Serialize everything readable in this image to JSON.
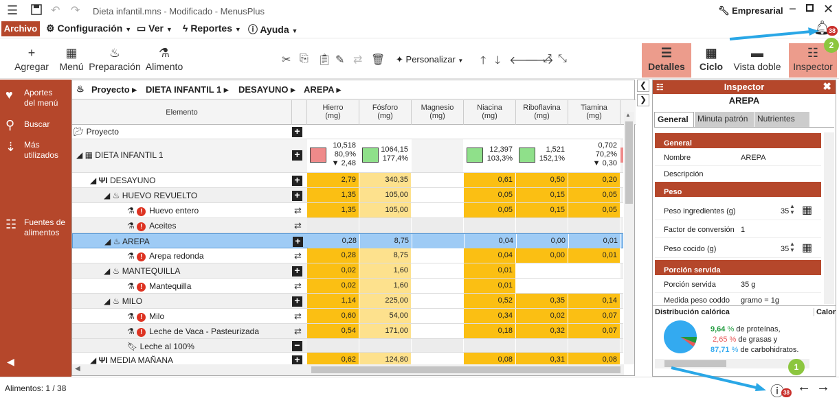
{
  "window": {
    "title": "Dieta infantil.mns - Modificado - MenusPlus",
    "edition": "Empresarial",
    "notification_count": "38"
  },
  "menubar": {
    "archivo": "Archivo",
    "configuracion": "Configuración",
    "ver": "Ver",
    "reportes": "Reportes",
    "ayuda": "Ayuda"
  },
  "ribbon": {
    "agregar": "Agregar",
    "menu": "Menú",
    "preparacion": "Preparación",
    "alimento": "Alimento",
    "personalizar": "Personalizar",
    "detalles": "Detalles",
    "ciclo": "Ciclo",
    "vista_doble": "Vista doble",
    "inspector": "Inspector"
  },
  "sidebar": {
    "aportes": "Aportes del menú",
    "buscar": "Buscar",
    "mas_utilizados": "Más utilizados",
    "fuentes": "Fuentes de alimentos"
  },
  "breadcrumb": [
    "Proyecto",
    "DIETA INFANTIL 1",
    "DESAYUNO",
    "AREPA"
  ],
  "grid": {
    "element_header": "Elemento",
    "columns": [
      {
        "name": "Hierro",
        "unit": "(mg)"
      },
      {
        "name": "Fósforo",
        "unit": "(mg)"
      },
      {
        "name": "Magnesio",
        "unit": "(mg)"
      },
      {
        "name": "Niacina",
        "unit": "(mg)"
      },
      {
        "name": "Riboflavina",
        "unit": "(mg)"
      },
      {
        "name": "Tiamina",
        "unit": "(mg)"
      }
    ],
    "proyecto_row": "Proyecto",
    "dieta_row": {
      "name": "DIETA INFANTIL 1",
      "hierro": [
        "10,518",
        "80,9%",
        "▼ 2,48"
      ],
      "fosforo": [
        "1064,15",
        "177,4%"
      ],
      "niacina": [
        "12,397",
        "103,3%"
      ],
      "riboflavina": [
        "1,521",
        "152,1%"
      ],
      "tiamina": [
        "0,702",
        "70,2%",
        "▼ 0,30"
      ]
    },
    "rows": [
      {
        "name": "DESAYUNO",
        "vals": [
          "2,79",
          "340,35",
          "",
          "0,61",
          "0,50",
          "0,20"
        ]
      },
      {
        "name": "HUEVO REVUELTO",
        "vals": [
          "1,35",
          "105,00",
          "",
          "0,05",
          "0,15",
          "0,05"
        ]
      },
      {
        "name": "Huevo entero",
        "vals": [
          "1,35",
          "105,00",
          "",
          "0,05",
          "0,15",
          "0,05"
        ]
      },
      {
        "name": "Aceites",
        "vals": [
          "",
          "",
          "",
          "",
          "",
          ""
        ]
      },
      {
        "name": "AREPA",
        "vals": [
          "0,28",
          "8,75",
          "",
          "0,04",
          "0,00",
          "0,01"
        ]
      },
      {
        "name": "Arepa redonda",
        "vals": [
          "0,28",
          "8,75",
          "",
          "0,04",
          "0,00",
          "0,01"
        ]
      },
      {
        "name": "MANTEQUILLA",
        "vals": [
          "0,02",
          "1,60",
          "",
          "0,01",
          "",
          ""
        ]
      },
      {
        "name": "Mantequilla",
        "vals": [
          "0,02",
          "1,60",
          "",
          "0,01",
          "",
          ""
        ]
      },
      {
        "name": "MILO",
        "vals": [
          "1,14",
          "225,00",
          "",
          "0,52",
          "0,35",
          "0,14"
        ]
      },
      {
        "name": "Milo",
        "vals": [
          "0,60",
          "54,00",
          "",
          "0,34",
          "0,02",
          "0,07"
        ]
      },
      {
        "name": "Leche de Vaca - Pasteurizada",
        "vals": [
          "0,54",
          "171,00",
          "",
          "0,18",
          "0,32",
          "0,07"
        ]
      },
      {
        "name": "Leche al 100%",
        "vals": [
          "",
          "",
          "",
          "",
          "",
          ""
        ]
      },
      {
        "name": "MEDIA MAÑANA",
        "vals": [
          "0,62",
          "124,80",
          "",
          "0,08",
          "0,31",
          "0,08"
        ]
      }
    ]
  },
  "inspector": {
    "title": "Inspector",
    "item": "AREPA",
    "tabs": [
      "General",
      "Minuta patrón",
      "Nutrientes"
    ],
    "sec_general": "General",
    "nombre_k": "Nombre",
    "nombre_v": "AREPA",
    "descripcion_k": "Descripción",
    "sec_peso": "Peso",
    "peso_ing_k": "Peso ingredientes (g)",
    "peso_ing_v": "35",
    "factor_k": "Factor de conversión",
    "factor_v": "1",
    "peso_coc_k": "Peso cocido (g)",
    "peso_coc_v": "35",
    "sec_porcion": "Porción servida",
    "porcion_k": "Porción servida",
    "porcion_v": "35 g",
    "medida_k": "Medida peso coddo",
    "medida_v": "gramo = 1g",
    "dist_title": "Distribución calórica",
    "calor_title": "Calor",
    "prot_val": "9,64",
    "prot_txt": "de proteínas,",
    "gras_val": "2,65",
    "gras_txt": "de grasas y",
    "carb_val": "87,71",
    "carb_txt": "de carbohidratos.",
    "pct": "%"
  },
  "status": {
    "alimentos": "Alimentos: 1 / 38",
    "badge": "38"
  },
  "callouts": {
    "one": "1",
    "two": "2"
  },
  "colors": {
    "accent": "#b5472b",
    "yellow": "#fbbf13",
    "selection": "#9ecbf5"
  }
}
